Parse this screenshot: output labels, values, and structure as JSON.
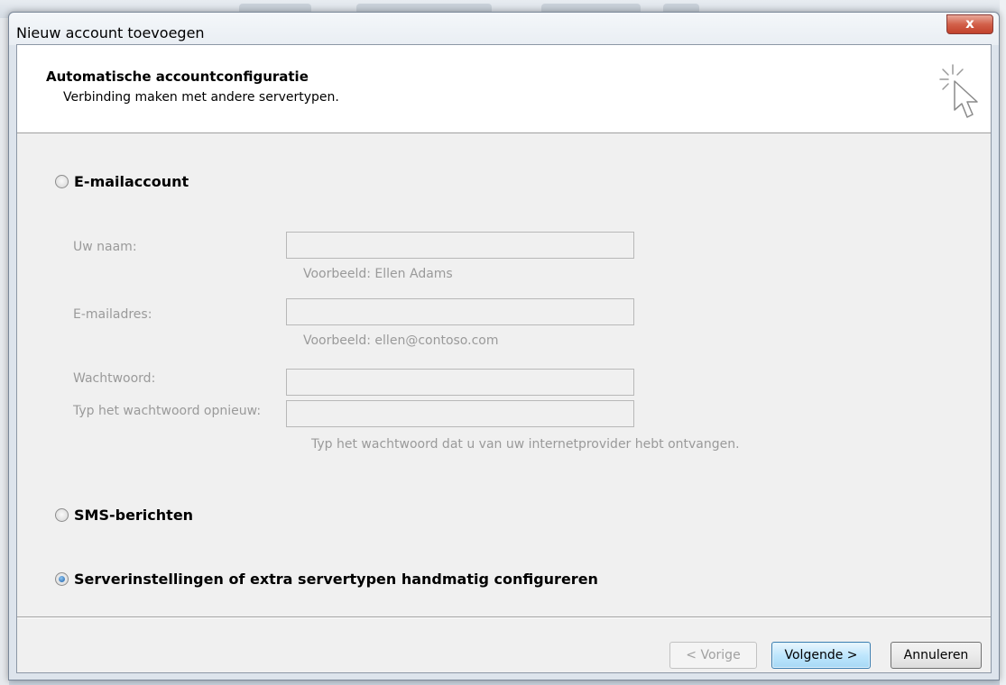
{
  "dialog": {
    "title": "Nieuw account toevoegen",
    "close_label": "x"
  },
  "header": {
    "title": "Automatische accountconfiguratie",
    "subtitle": "Verbinding maken met andere servertypen."
  },
  "options": {
    "email_account": {
      "label": "E-mailaccount",
      "selected": false
    },
    "sms": {
      "label": "SMS-berichten",
      "selected": false
    },
    "manual": {
      "label": "Serverinstellingen of extra servertypen handmatig configureren",
      "selected": true
    }
  },
  "form": {
    "name": {
      "label": "Uw naam:",
      "value": "",
      "hint": "Voorbeeld: Ellen Adams"
    },
    "email": {
      "label": "E-mailadres:",
      "value": "",
      "hint": "Voorbeeld: ellen@contoso.com"
    },
    "password": {
      "label": "Wachtwoord:",
      "value": ""
    },
    "password_repeat": {
      "label": "Typ het wachtwoord opnieuw:",
      "value": "",
      "hint": "Typ het wachtwoord dat u van uw internetprovider hebt ontvangen."
    }
  },
  "buttons": {
    "prev": "< Vorige",
    "next": "Volgende >",
    "cancel": "Annuleren"
  },
  "icons": {
    "wizard": "cursor-sparkle-icon",
    "close": "close-icon"
  }
}
